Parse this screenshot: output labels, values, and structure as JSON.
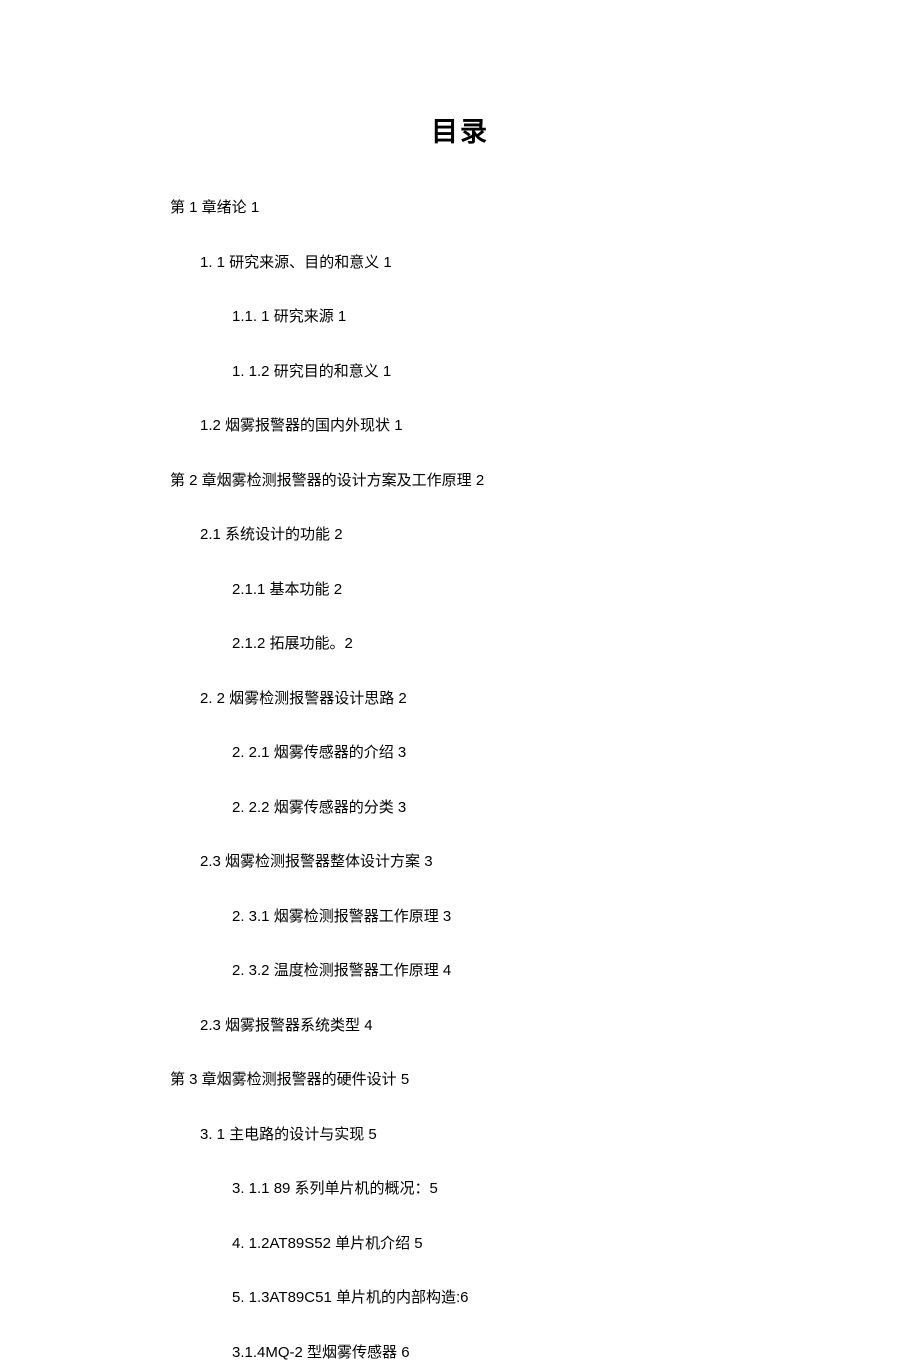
{
  "title": "目录",
  "toc": [
    {
      "level": 1,
      "text": "第 1 章绪论 1"
    },
    {
      "level": 2,
      "text": "1.  1 研究来源、目的和意义 1"
    },
    {
      "level": 3,
      "text": "1.1.  1 研究来源 1"
    },
    {
      "level": 3,
      "text": "1.  1.2 研究目的和意义 1"
    },
    {
      "level": 2,
      "text": "1.2 烟雾报警器的国内外现状 1"
    },
    {
      "level": 1,
      "text": "第 2 章烟雾检测报警器的设计方案及工作原理 2"
    },
    {
      "level": 2,
      "text": "2.1   系统设计的功能 2"
    },
    {
      "level": 3,
      "text": "2.1.1    基本功能 2"
    },
    {
      "level": 3,
      "text": "2.1.2    拓展功能。2"
    },
    {
      "level": 2,
      "text": "2.  2 烟雾检测报警器设计思路 2"
    },
    {
      "level": 3,
      "text": "2.  2.1 烟雾传感器的介绍 3"
    },
    {
      "level": 3,
      "text": "2.  2.2 烟雾传感器的分类 3"
    },
    {
      "level": 2,
      "text": "2.3 烟雾检测报警器整体设计方案 3"
    },
    {
      "level": 3,
      "text": "2.  3.1 烟雾检测报警器工作原理 3"
    },
    {
      "level": 3,
      "text": "2.  3.2 温度检测报警器工作原理 4"
    },
    {
      "level": 2,
      "text": "2.3 烟雾报警器系统类型 4"
    },
    {
      "level": 1,
      "text": "第 3 章烟雾检测报警器的硬件设计 5"
    },
    {
      "level": 2,
      "text": "3.  1 主电路的设计与实现 5"
    },
    {
      "level": 3,
      "text": "3.  1.1   89 系列单片机的概况：5"
    },
    {
      "level": 3,
      "text": "4.  1.2AT89S52 单片机介绍 5"
    },
    {
      "level": 3,
      "text": "5.  1.3AT89C51 单片机的内部构造:6"
    },
    {
      "level": 3,
      "text": "3.1.4MQ-2 型烟雾传感器 6"
    }
  ]
}
